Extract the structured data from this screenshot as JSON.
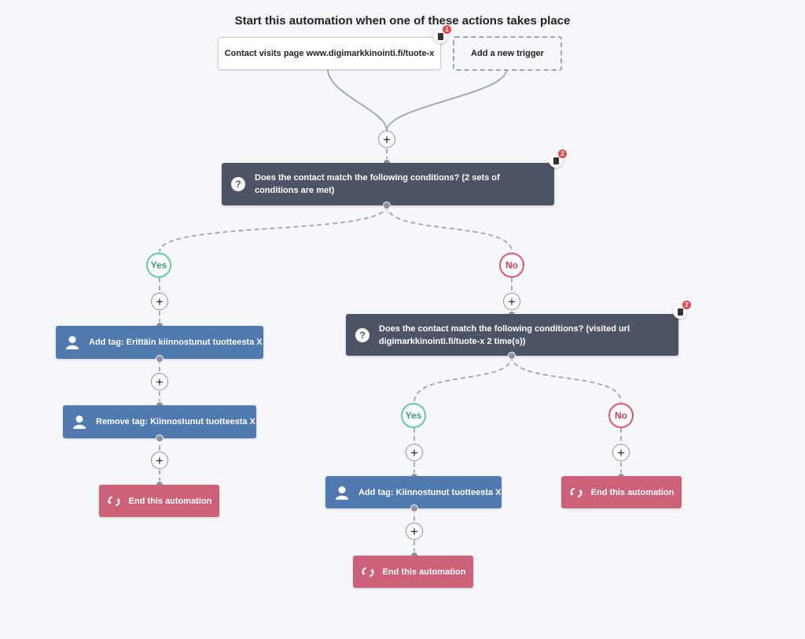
{
  "header": {
    "title": "Start this automation when one of these actions takes place"
  },
  "triggers": [
    {
      "label": "Contact visits page www.digimarkkinointi.fi/tuote-x",
      "badge_count": "1"
    },
    {
      "label": "Add a new trigger"
    }
  ],
  "condition1": {
    "text": "Does the contact match the following conditions? (2 sets of conditions are met)",
    "badge_count": "2",
    "icon": "question-icon"
  },
  "branch_labels": {
    "yes": "Yes",
    "no": "No"
  },
  "yes_branch": {
    "action1": "Add tag: Erittäin kiinnostunut tuotteesta X",
    "action2": "Remove tag: Kiinnostunut tuotteesta X",
    "end": "End this automation"
  },
  "condition2": {
    "text": "Does the contact match the following conditions? (visited url digimarkkinointi.fi/tuote-x 2 time(s))",
    "badge_count": "2",
    "icon": "question-icon"
  },
  "no_yes_branch": {
    "action1": "Add tag: Kiinnostunut tuotteesta X",
    "end": "End this automation"
  },
  "no_no_branch": {
    "end": "End this automation"
  },
  "plus_symbol": "+",
  "question_symbol": "?",
  "colors": {
    "condition": "#4f5366",
    "action": "#5079b0",
    "end": "#cc6179",
    "yes": "#62c9a0",
    "no": "#e0556d"
  }
}
